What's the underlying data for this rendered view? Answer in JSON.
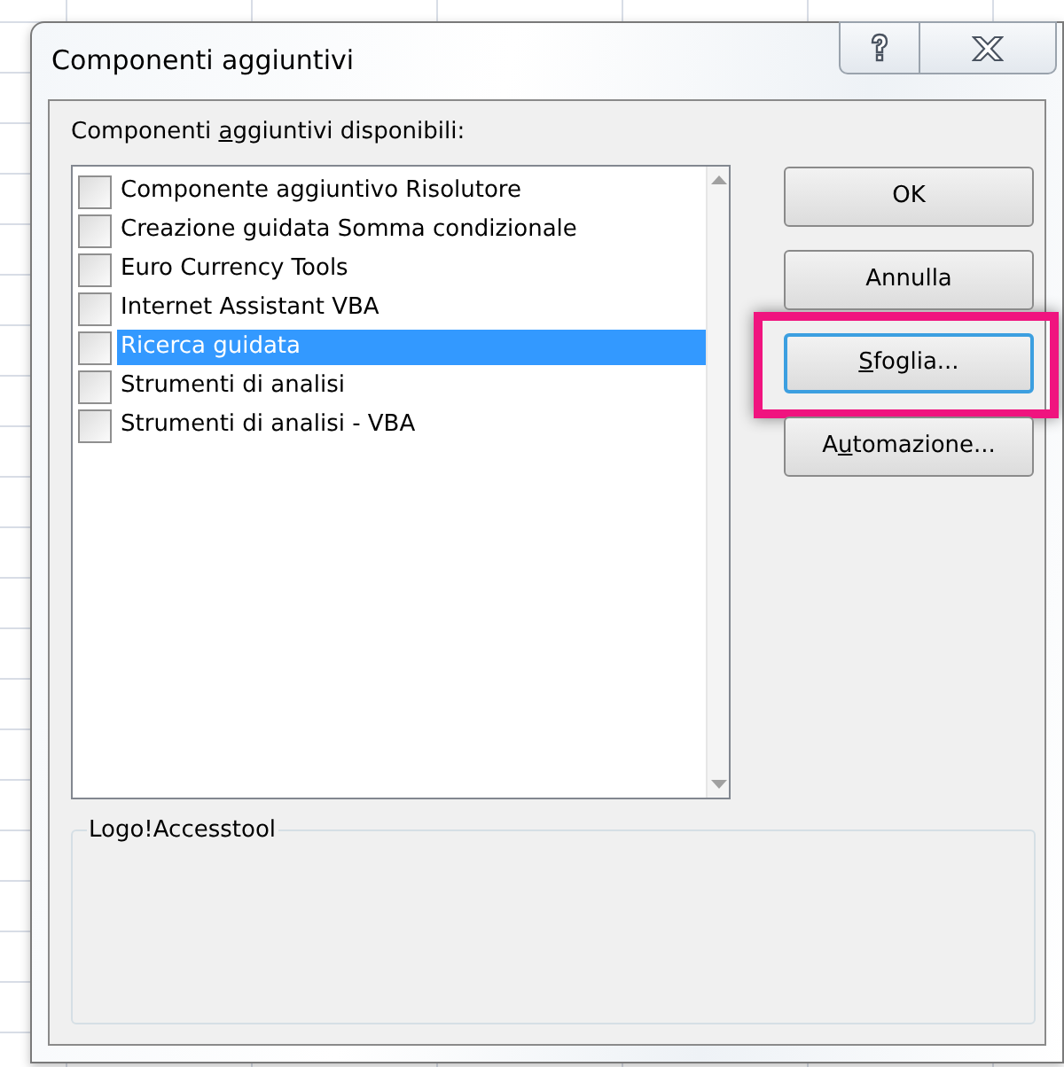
{
  "window": {
    "title": "Componenti aggiuntivi",
    "title_buttons": [
      {
        "kind": "help"
      },
      {
        "kind": "close"
      }
    ]
  },
  "addins_label": {
    "text_before": "Componenti ",
    "access_key": "a",
    "text_after": "ggiuntivi disponibili:"
  },
  "addins": [
    {
      "label": "Componente aggiuntivo Risolutore",
      "checked": false,
      "selected": false
    },
    {
      "label": "Creazione guidata Somma condizionale",
      "checked": false,
      "selected": false
    },
    {
      "label": "Euro Currency Tools",
      "checked": false,
      "selected": false
    },
    {
      "label": "Internet Assistant VBA",
      "checked": false,
      "selected": false
    },
    {
      "label": "Ricerca guidata",
      "checked": false,
      "selected": true
    },
    {
      "label": "Strumenti di analisi",
      "checked": false,
      "selected": false
    },
    {
      "label": "Strumenti di analisi - VBA",
      "checked": false,
      "selected": false
    }
  ],
  "buttons": [
    {
      "text_before": "OK",
      "focused": false,
      "highlighted": false
    },
    {
      "text_before": "Annulla",
      "focused": false,
      "highlighted": false
    },
    {
      "access_key": "S",
      "text_after": "foglia...",
      "focused": true,
      "highlighted": true
    },
    {
      "text_before": "A",
      "access_key": "u",
      "text_after": "tomazione...",
      "focused": false,
      "highlighted": false
    }
  ],
  "description_group": {
    "title": "Logo!Accesstool"
  }
}
